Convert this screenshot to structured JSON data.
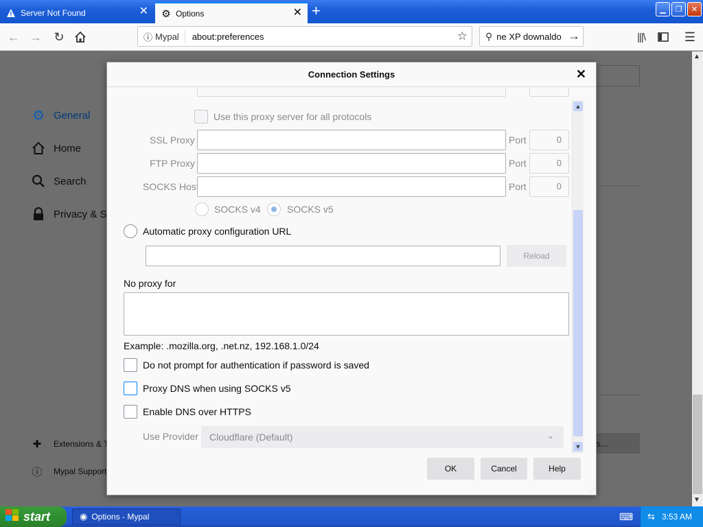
{
  "tabs": [
    {
      "label": "Server Not Found",
      "icon": "warning-icon"
    },
    {
      "label": "Options",
      "icon": "gear-icon"
    }
  ],
  "navbar": {
    "identity_label": "Mypal",
    "url": "about:preferences",
    "search_value": "ne XP downaldo"
  },
  "sidebar": {
    "items": [
      {
        "label": "General",
        "icon": "gear-icon"
      },
      {
        "label": "Home",
        "icon": "home-icon"
      },
      {
        "label": "Search",
        "icon": "search-icon"
      },
      {
        "label": "Privacy & Se",
        "icon": "lock-icon"
      }
    ],
    "footer": [
      {
        "label": "Extensions & T",
        "icon": "puzzle-icon"
      },
      {
        "label": "Mypal Support",
        "icon": "help-icon"
      }
    ],
    "page_button_label": "s..."
  },
  "dialog": {
    "title": "Connection Settings",
    "use_for_all_label": "Use this proxy server for all protocols",
    "ssl_label": "SSL Proxy",
    "ftp_label": "FTP Proxy",
    "socks_label": "SOCKS Host",
    "port_label": "Port",
    "ssl_port": "0",
    "ftp_port": "0",
    "socks_port": "0",
    "socks_v4_label": "SOCKS v4",
    "socks_v5_label": "SOCKS v5",
    "auto_proxy_label": "Automatic proxy configuration URL",
    "reload_label": "Reload",
    "no_proxy_label": "No proxy for",
    "example_text": "Example: .mozilla.org, .net.nz, 192.168.1.0/24",
    "no_auth_prompt_label": "Do not prompt for authentication if password is saved",
    "proxy_dns_label": "Proxy DNS when using SOCKS v5",
    "enable_doh_label": "Enable DNS over HTTPS",
    "use_provider_label": "Use Provider",
    "provider_value": "Cloudflare (Default)",
    "ok_label": "OK",
    "cancel_label": "Cancel",
    "help_label": "Help"
  },
  "taskbar": {
    "start_label": "start",
    "task_label": "Options - Mypal",
    "clock": "3:53 AM"
  }
}
